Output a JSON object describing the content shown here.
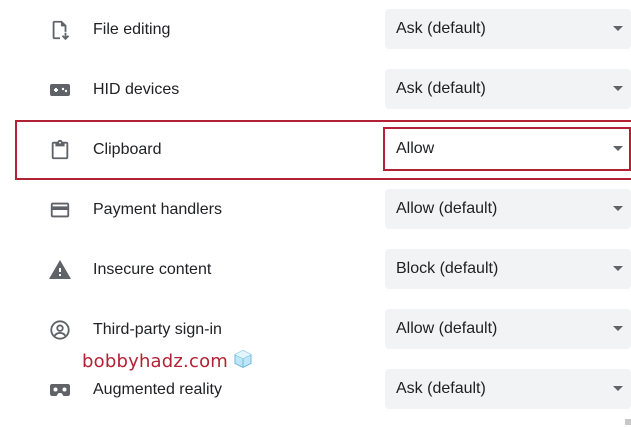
{
  "rows": [
    {
      "label": "File editing",
      "value": "Ask (default)",
      "icon": "file-editing-icon"
    },
    {
      "label": "HID devices",
      "value": "Ask (default)",
      "icon": "hid-devices-icon"
    },
    {
      "label": "Clipboard",
      "value": "Allow",
      "icon": "clipboard-icon"
    },
    {
      "label": "Payment handlers",
      "value": "Allow (default)",
      "icon": "credit-card-icon"
    },
    {
      "label": "Insecure content",
      "value": "Block (default)",
      "icon": "warning-icon"
    },
    {
      "label": "Third-party sign-in",
      "value": "Allow (default)",
      "icon": "account-circle-icon"
    },
    {
      "label": "Augmented reality",
      "value": "Ask (default)",
      "icon": "vr-headset-icon"
    }
  ],
  "watermark": {
    "text": "bobbyhadz.com",
    "icon": "ice-cube-icon"
  },
  "colors": {
    "highlight": "#b22234",
    "select_background": "#f1f3f4",
    "icon": "#5f6368",
    "text": "#202124"
  }
}
